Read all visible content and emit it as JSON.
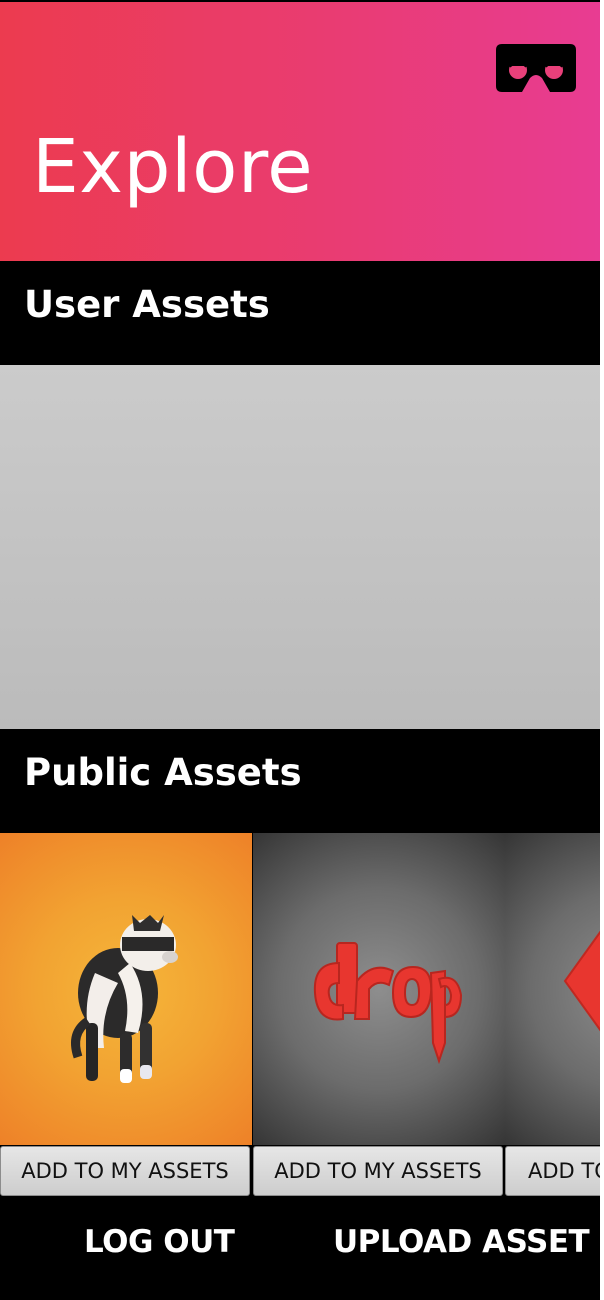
{
  "header": {
    "title": "Explore",
    "vr_icon": "vr-headset-icon",
    "gradient_colors": [
      "#ec3b4f",
      "#e83c92"
    ]
  },
  "sections": {
    "user_assets_title": "User Assets",
    "public_assets_title": "Public Assets"
  },
  "public_assets": [
    {
      "thumbnail": "ferret-model",
      "button_label": "ADD TO MY ASSETS"
    },
    {
      "thumbnail": "drop-logo-model",
      "button_label": "ADD TO MY ASSETS"
    },
    {
      "thumbnail": "red-diamond-model",
      "button_label": "ADD TO MY ASSETS"
    }
  ],
  "bottom_bar": {
    "logout_label": "LOG OUT",
    "upload_label": "UPLOAD ASSET"
  },
  "colors": {
    "accent_red": "#ec3b4f",
    "accent_pink": "#e83c92",
    "asset_red": "#e8362f"
  }
}
